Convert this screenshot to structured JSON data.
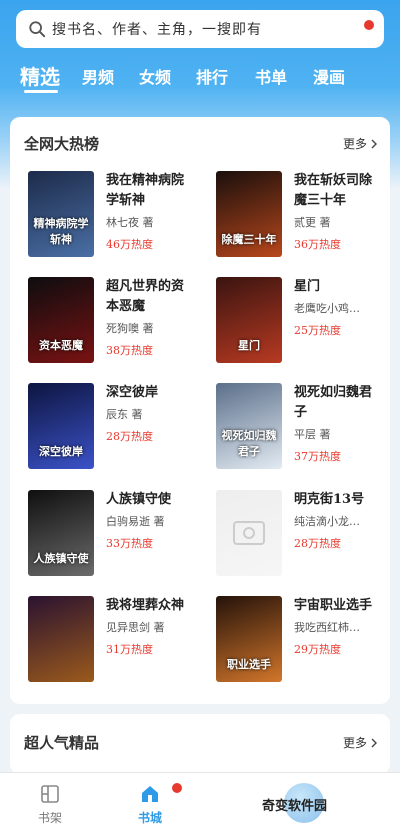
{
  "search": {
    "placeholder": "搜书名、作者、主角，一搜即有"
  },
  "tabs": [
    {
      "label": "精选"
    },
    {
      "label": "男频"
    },
    {
      "label": "女频"
    },
    {
      "label": "排行"
    },
    {
      "label": "书单"
    },
    {
      "label": "漫画"
    }
  ],
  "section1": {
    "title": "全网大热榜",
    "more": "更多",
    "books": [
      {
        "title": "我在精神病院学斩神",
        "author": "林七夜 著",
        "heat": "46万热度",
        "cover_text": "精神病院学斩神",
        "cover_colors": [
          "#1d2b4a",
          "#4a6fa5"
        ]
      },
      {
        "title": "我在斩妖司除魔三十年",
        "author": "贰更 著",
        "heat": "36万热度",
        "cover_text": "除魔三十年",
        "cover_colors": [
          "#1a0f0c",
          "#b8471c"
        ]
      },
      {
        "title": "超凡世界的资本恶魔",
        "author": "死狗噢 著",
        "heat": "38万热度",
        "cover_text": "资本恶魔",
        "cover_colors": [
          "#0d0d10",
          "#7a1212"
        ]
      },
      {
        "title": "星门",
        "author": "老鹰吃小鸡…",
        "heat": "25万热度",
        "cover_text": "星门",
        "cover_colors": [
          "#3a1410",
          "#b83a22"
        ]
      },
      {
        "title": "深空彼岸",
        "author": "辰东 著",
        "heat": "28万热度",
        "cover_text": "深空彼岸",
        "cover_colors": [
          "#0d1540",
          "#3b52c8"
        ]
      },
      {
        "title": "视死如归魏君子",
        "author": "平层 著",
        "heat": "37万热度",
        "cover_text": "视死如归魏君子",
        "cover_colors": [
          "#5b6f8a",
          "#e3ebf3"
        ]
      },
      {
        "title": "人族镇守使",
        "author": "白驹易逝 著",
        "heat": "33万热度",
        "cover_text": "人族镇守使",
        "cover_colors": [
          "#0f0f0f",
          "#6b6b6b"
        ]
      },
      {
        "title": "明克街13号",
        "author": "纯洁滴小龙…",
        "heat": "28万热度",
        "cover_text": "",
        "cover_colors": [
          "#eeeeee",
          "#f6f6f6"
        ]
      },
      {
        "title": "我将埋葬众神",
        "author": "见异思剑 著",
        "heat": "31万热度",
        "cover_text": "",
        "cover_colors": [
          "#2a1230",
          "#9b5a1c"
        ]
      },
      {
        "title": "宇宙职业选手",
        "author": "我吃西红柿…",
        "heat": "29万热度",
        "cover_text": "职业选手",
        "cover_colors": [
          "#24120a",
          "#d2762b"
        ]
      }
    ]
  },
  "section2": {
    "title": "超人气精品",
    "more": "更多"
  },
  "bottom_nav": [
    {
      "label": "书架",
      "icon": "bookshelf-icon",
      "active": false
    },
    {
      "label": "书城",
      "icon": "bookstore-icon",
      "active": true
    }
  ],
  "watermark": "奇变软件园",
  "colors": {
    "accent": "#2f9be6",
    "heat": "#e8392e",
    "badge": "#e8392e"
  }
}
